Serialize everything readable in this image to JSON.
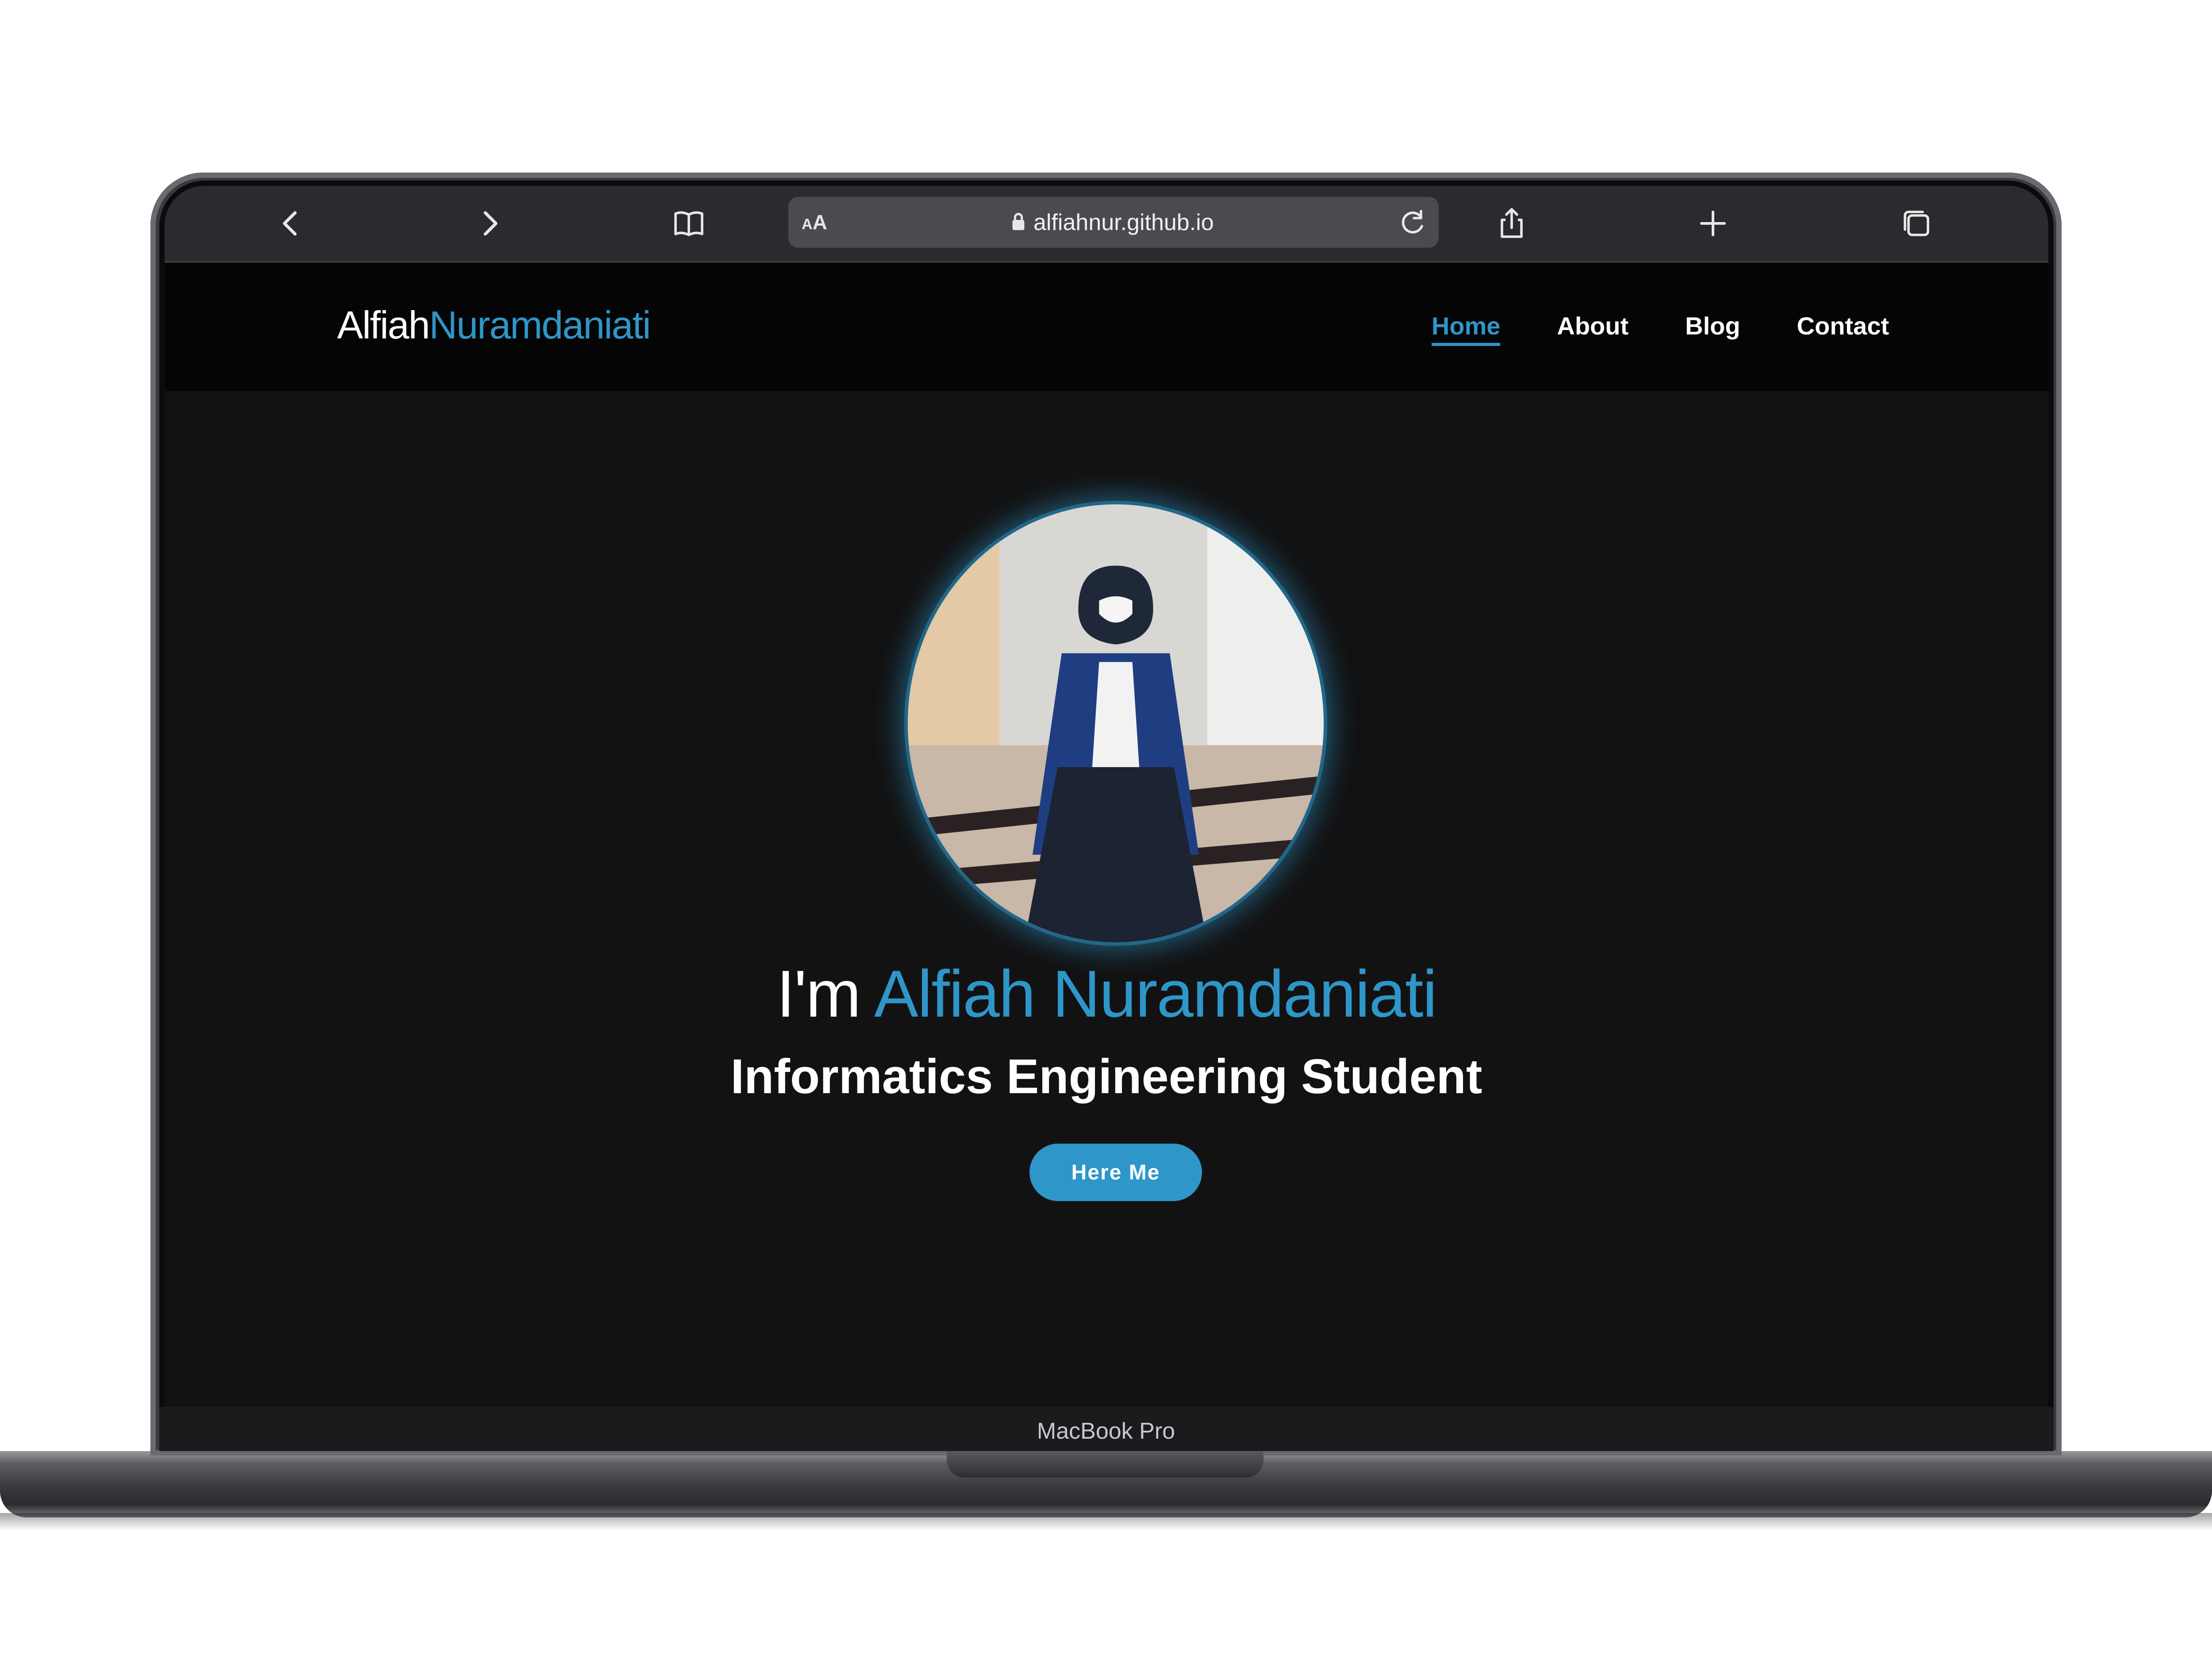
{
  "device": {
    "model_label": "MacBook Pro"
  },
  "browser": {
    "aa_label_small": "A",
    "aa_label_big": "A",
    "url": "alfiahnur.github.io",
    "icons": [
      "chevron-left-icon",
      "chevron-right-icon",
      "book-icon",
      "lock-icon",
      "reload-icon",
      "share-icon",
      "plus-icon",
      "tabs-icon"
    ]
  },
  "site": {
    "logo_first": "Alfiah",
    "logo_second": "Nuramdaniati",
    "nav": [
      {
        "label": "Home",
        "active": true
      },
      {
        "label": "About",
        "active": false
      },
      {
        "label": "Blog",
        "active": false
      },
      {
        "label": "Contact",
        "active": false
      }
    ],
    "hero": {
      "greeting": "I'm",
      "name": "Alfiah Nuramdaniati",
      "subtitle": "Informatics Engineering Student",
      "button": "Here Me"
    }
  },
  "colors": {
    "accent": "#2e96c8",
    "background": "#121213",
    "header": "#050506"
  }
}
